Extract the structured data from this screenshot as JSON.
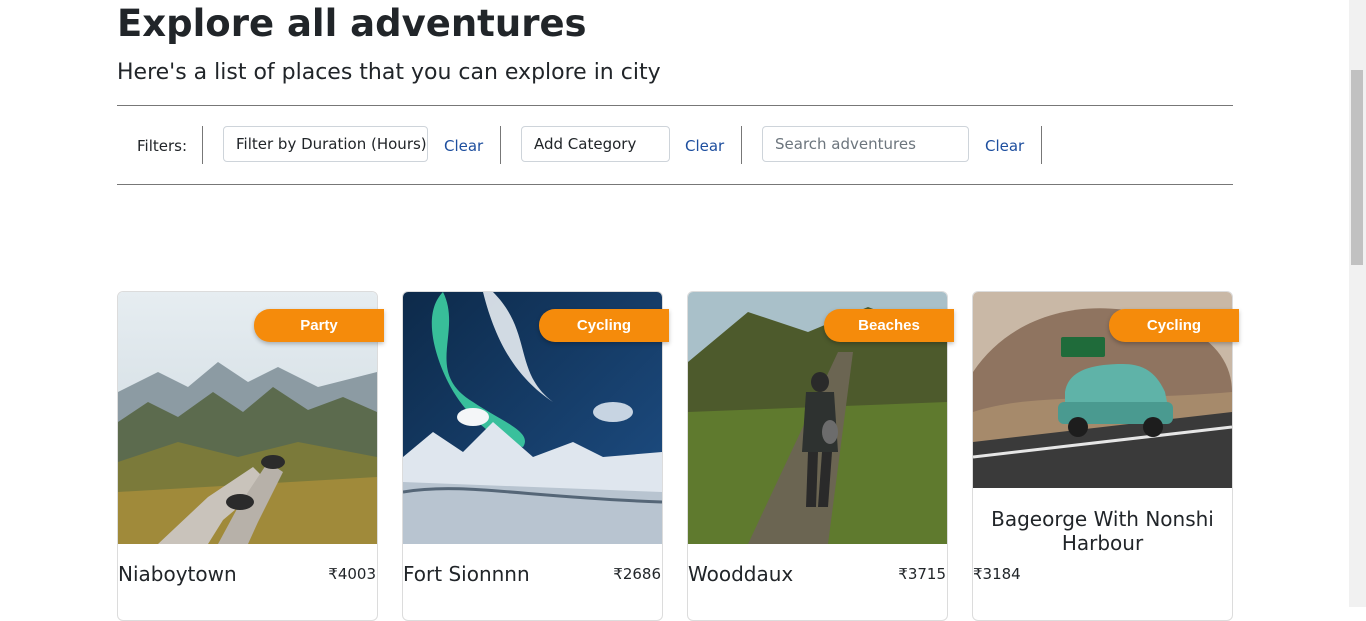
{
  "header": {
    "title": "Explore all adventures",
    "subtitle": "Here's a list of places that you can explore in city"
  },
  "filters": {
    "label": "Filters:",
    "duration": "Filter by Duration (Hours)",
    "category": "Add Category",
    "search_placeholder": "Search adventures",
    "clear_label": "Clear"
  },
  "cards": [
    {
      "category": "Party",
      "name": "Niaboytown",
      "price": "₹4003",
      "image": "mountain-view-photo"
    },
    {
      "category": "Cycling",
      "name": "Fort Sionnnn",
      "price": "₹2686",
      "image": "aurora-snow-photo"
    },
    {
      "category": "Beaches",
      "name": "Wooddaux",
      "price": "₹3715",
      "image": "hiker-trail-photo"
    },
    {
      "category": "Cycling",
      "name": "Bageorge With Nonshi Harbour",
      "price": "₹3184",
      "image": "vintage-car-photo"
    }
  ],
  "colors": {
    "badge": "#f58b0b",
    "link": "#1d4e9e",
    "text": "#212529"
  }
}
